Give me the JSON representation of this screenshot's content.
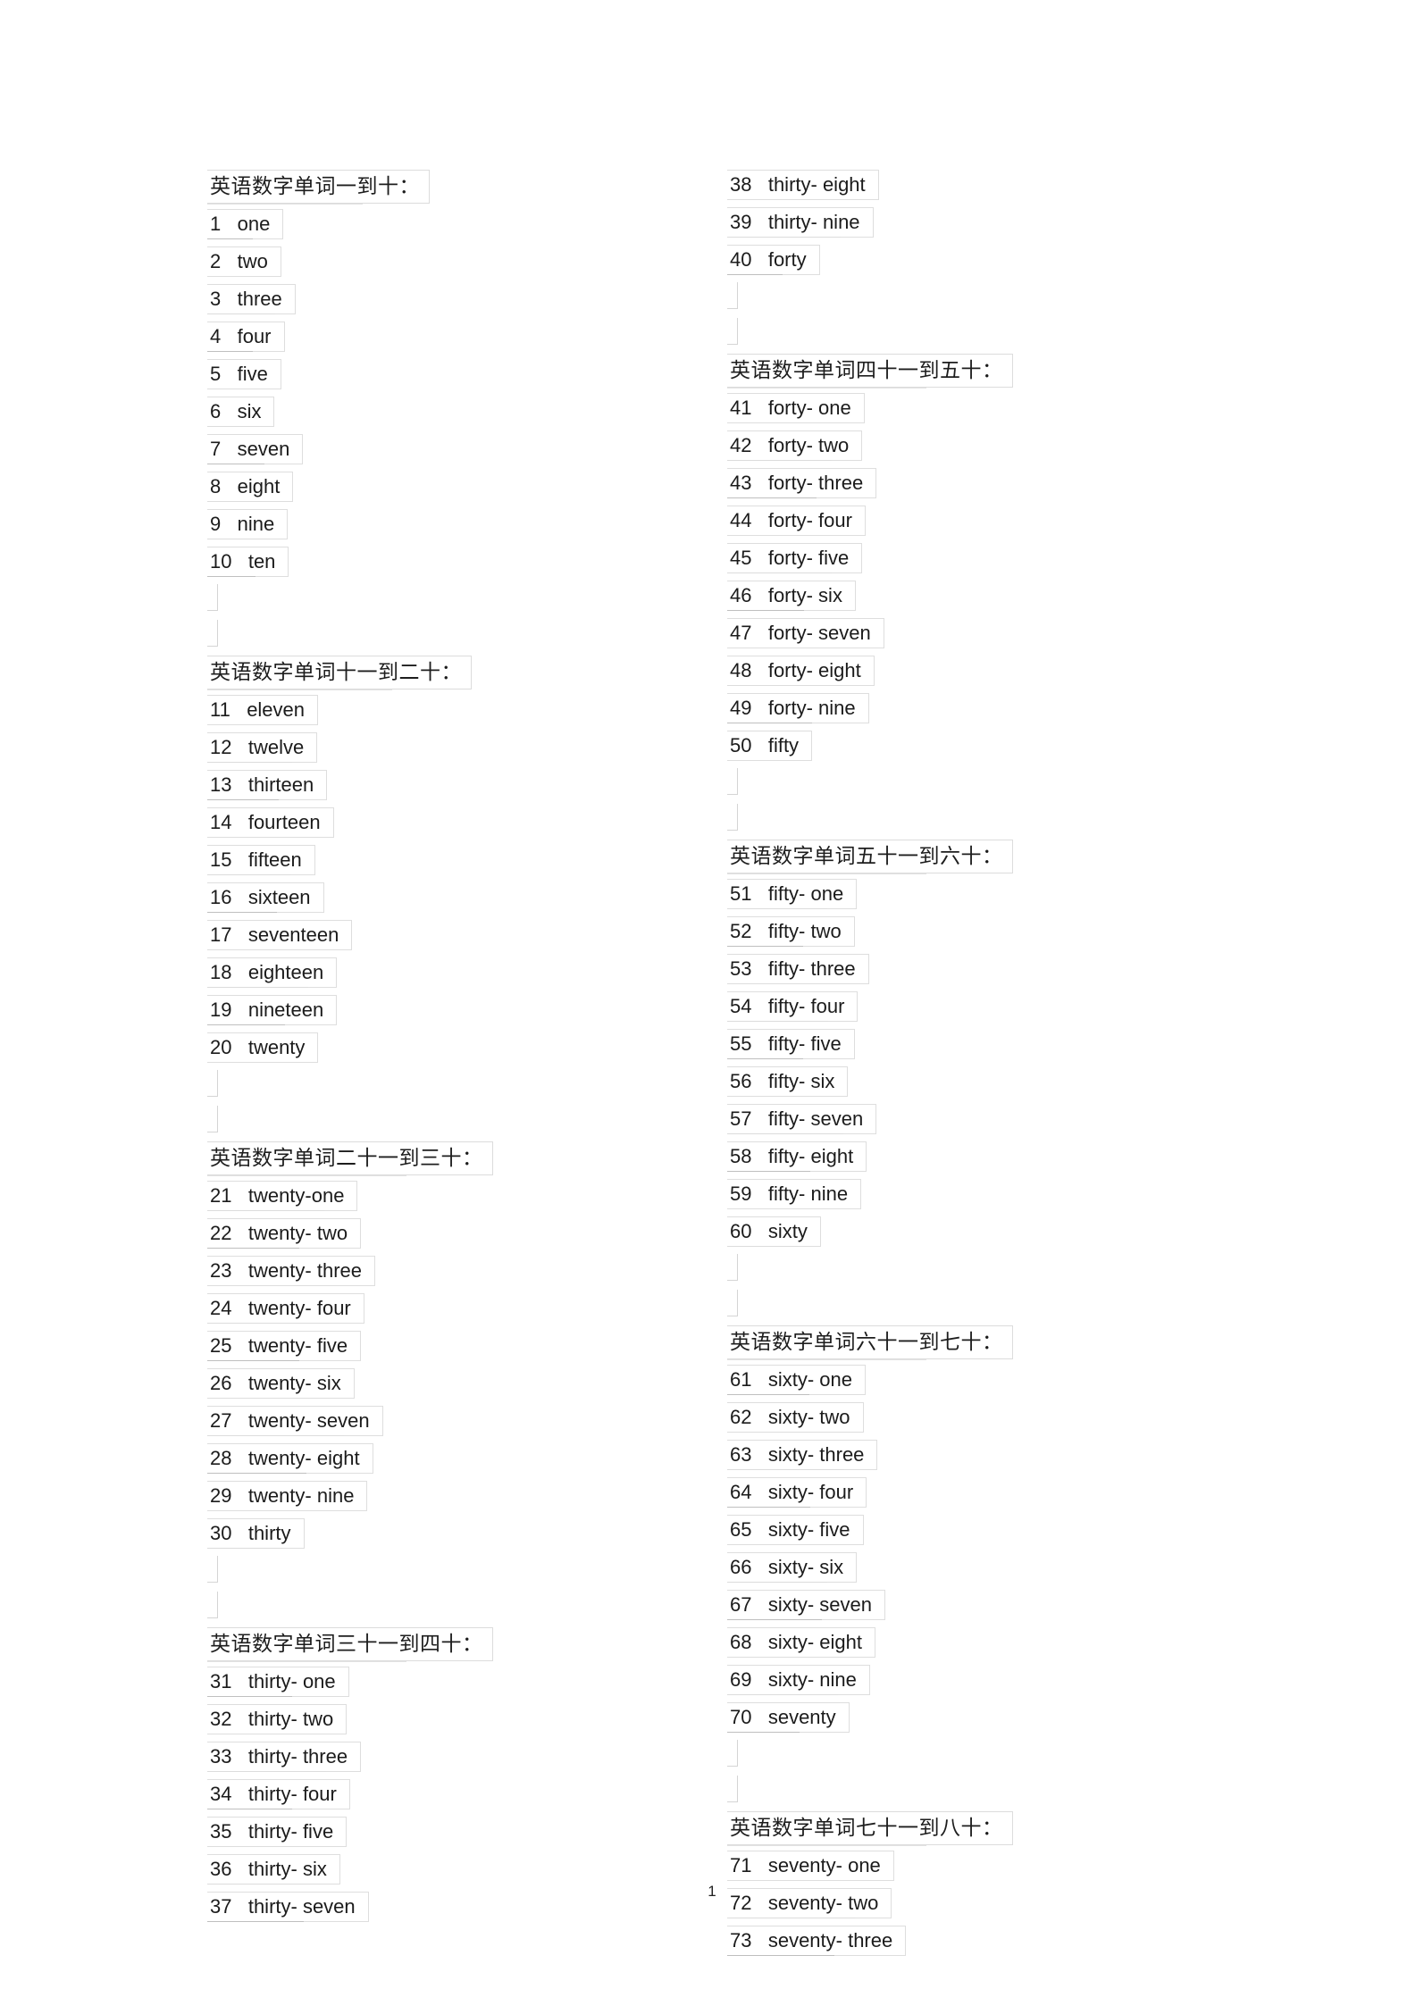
{
  "document": {
    "page_number": "1",
    "background_color": "#ffffff",
    "text_color": "#1a1a1a",
    "box_border_color": "#dcdcdc"
  },
  "columns": {
    "left": {
      "blocks": [
        {
          "type": "section",
          "heading": "英语数字单词一到十：",
          "entries": [
            {
              "num": "1",
              "word": "one"
            },
            {
              "num": "2",
              "word": "two"
            },
            {
              "num": "3",
              "word": "three"
            },
            {
              "num": "4",
              "word": "four"
            },
            {
              "num": "5",
              "word": "five"
            },
            {
              "num": "6",
              "word": "six"
            },
            {
              "num": "7",
              "word": "seven"
            },
            {
              "num": "8",
              "word": "eight"
            },
            {
              "num": "9",
              "word": "nine"
            },
            {
              "num": "10",
              "word": "ten"
            }
          ]
        },
        {
          "type": "section",
          "heading": "英语数字单词十一到二十：",
          "entries": [
            {
              "num": "11",
              "word": "eleven"
            },
            {
              "num": "12",
              "word": "twelve"
            },
            {
              "num": "13",
              "word": "thirteen"
            },
            {
              "num": "14",
              "word": "fourteen"
            },
            {
              "num": "15",
              "word": "fifteen"
            },
            {
              "num": "16",
              "word": "sixteen"
            },
            {
              "num": "17",
              "word": "seventeen"
            },
            {
              "num": "18",
              "word": "eighteen"
            },
            {
              "num": "19",
              "word": "nineteen"
            },
            {
              "num": "20",
              "word": "twenty"
            }
          ]
        },
        {
          "type": "section",
          "heading": "英语数字单词二十一到三十：",
          "entries": [
            {
              "num": "21",
              "word": "twenty-one"
            },
            {
              "num": "22",
              "word": "twenty- two"
            },
            {
              "num": "23",
              "word": "twenty- three"
            },
            {
              "num": "24",
              "word": "twenty- four"
            },
            {
              "num": "25",
              "word": "twenty- five"
            },
            {
              "num": "26",
              "word": "twenty- six"
            },
            {
              "num": "27",
              "word": "twenty- seven"
            },
            {
              "num": "28",
              "word": "twenty- eight"
            },
            {
              "num": "29",
              "word": "twenty- nine"
            },
            {
              "num": "30",
              "word": "thirty"
            }
          ]
        },
        {
          "type": "section",
          "heading": "英语数字单词三十一到四十：",
          "entries": [
            {
              "num": "31",
              "word": "thirty- one"
            },
            {
              "num": "32",
              "word": "thirty- two"
            },
            {
              "num": "33",
              "word": "thirty- three"
            },
            {
              "num": "34",
              "word": "thirty- four"
            },
            {
              "num": "35",
              "word": "thirty- five"
            },
            {
              "num": "36",
              "word": "thirty- six"
            },
            {
              "num": "37",
              "word": "thirty- seven"
            }
          ]
        }
      ]
    },
    "right": {
      "blocks": [
        {
          "type": "continuation",
          "heading": "",
          "entries": [
            {
              "num": "38",
              "word": "thirty- eight"
            },
            {
              "num": "39",
              "word": "thirty- nine"
            },
            {
              "num": "40",
              "word": "forty"
            }
          ]
        },
        {
          "type": "section",
          "heading": "英语数字单词四十一到五十：",
          "entries": [
            {
              "num": "41",
              "word": "forty- one"
            },
            {
              "num": "42",
              "word": "forty- two"
            },
            {
              "num": "43",
              "word": "forty- three"
            },
            {
              "num": "44",
              "word": "forty- four"
            },
            {
              "num": "45",
              "word": "forty- five"
            },
            {
              "num": "46",
              "word": "forty- six"
            },
            {
              "num": "47",
              "word": "forty- seven"
            },
            {
              "num": "48",
              "word": "forty- eight"
            },
            {
              "num": "49",
              "word": "forty- nine"
            },
            {
              "num": "50",
              "word": "fifty"
            }
          ]
        },
        {
          "type": "section",
          "heading": "英语数字单词五十一到六十：",
          "entries": [
            {
              "num": "51",
              "word": "fifty- one"
            },
            {
              "num": "52",
              "word": "fifty- two"
            },
            {
              "num": "53",
              "word": "fifty- three"
            },
            {
              "num": "54",
              "word": "fifty- four"
            },
            {
              "num": "55",
              "word": "fifty- five"
            },
            {
              "num": "56",
              "word": "fifty- six"
            },
            {
              "num": "57",
              "word": "fifty- seven"
            },
            {
              "num": "58",
              "word": "fifty- eight"
            },
            {
              "num": "59",
              "word": "fifty- nine"
            },
            {
              "num": "60",
              "word": "sixty"
            }
          ]
        },
        {
          "type": "section",
          "heading": "英语数字单词六十一到七十：",
          "entries": [
            {
              "num": "61",
              "word": "sixty- one"
            },
            {
              "num": "62",
              "word": "sixty- two"
            },
            {
              "num": "63",
              "word": "sixty- three"
            },
            {
              "num": "64",
              "word": "sixty- four"
            },
            {
              "num": "65",
              "word": "sixty- five"
            },
            {
              "num": "66",
              "word": "sixty- six"
            },
            {
              "num": "67",
              "word": "sixty- seven"
            },
            {
              "num": "68",
              "word": "sixty- eight"
            },
            {
              "num": "69",
              "word": "sixty- nine"
            },
            {
              "num": "70",
              "word": "seventy"
            }
          ]
        },
        {
          "type": "section",
          "heading": "英语数字单词七十一到八十：",
          "entries": [
            {
              "num": "71",
              "word": "seventy- one"
            },
            {
              "num": "72",
              "word": "seventy- two"
            },
            {
              "num": "73",
              "word": "seventy- three"
            }
          ]
        }
      ]
    }
  }
}
